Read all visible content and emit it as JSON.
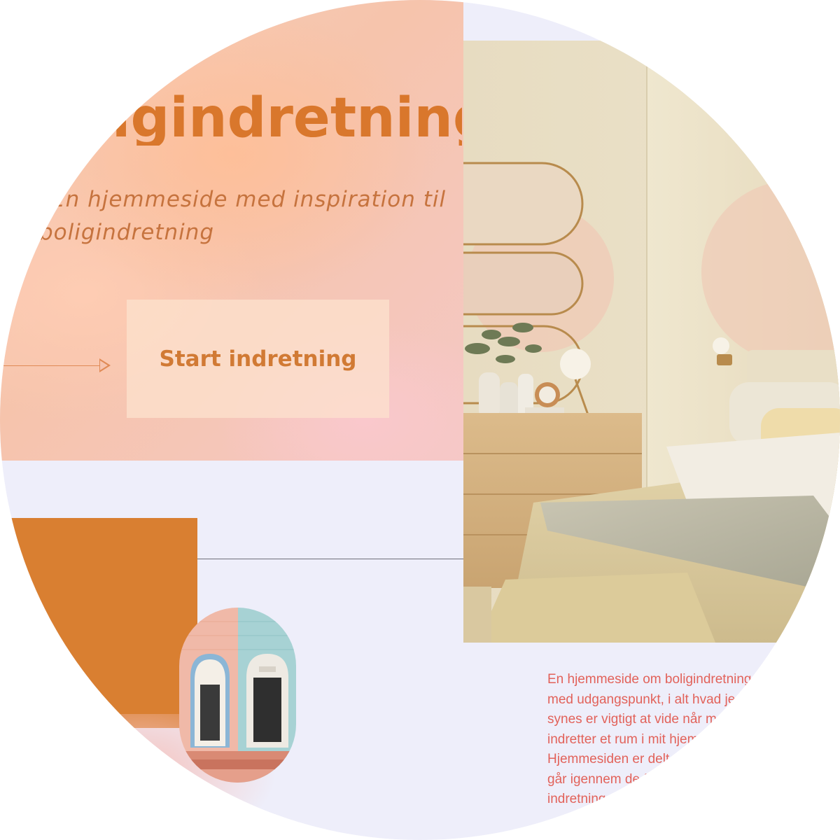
{
  "hero": {
    "title": "Boligindretning",
    "subtitle_line1": "En hjemmeside med inspiration til",
    "subtitle_line2": "boligindretning",
    "cta_label": "Start indretning"
  },
  "about": {
    "lines": [
      "En hjemmeside om boligindretning",
      "med udgangspunkt, i alt hvad jeg",
      "synes er vigtigt at vide når man",
      "indretter et rum i mit hjem.",
      "Hjemmesiden er delt op, så den",
      "går igennem de forskellige trin i",
      "indretningen."
    ]
  },
  "colors": {
    "accent": "#d97f31",
    "text_accent": "#e2625a",
    "background": "#eeeefa"
  },
  "icons": [
    "arrow-right-icon"
  ]
}
